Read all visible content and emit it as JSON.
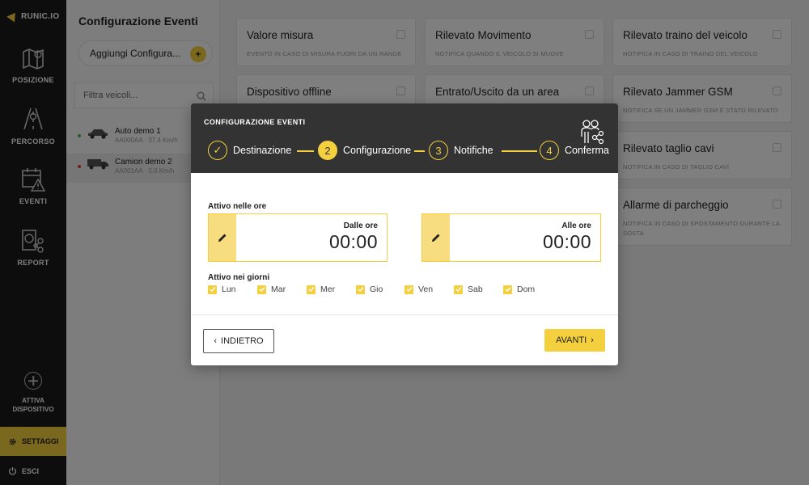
{
  "nav": {
    "brand": "RUNIC.IO",
    "items": [
      {
        "label": "POSIZIONE",
        "icon": "map-icon"
      },
      {
        "label": "PERCORSO",
        "icon": "route-icon"
      },
      {
        "label": "EVENTI",
        "icon": "calendar-alert-icon"
      },
      {
        "label": "REPORT",
        "icon": "report-icon"
      }
    ],
    "attiva": {
      "line1": "ATTIVA",
      "line2": "DISPOSITIVO"
    },
    "settings": "SETTAGGI",
    "logout": "ESCI"
  },
  "panel": {
    "title": "Configurazione Eventi",
    "add_button": "Aggiungi Configura...",
    "filter_placeholder": "Filtra veicoli...",
    "vehicles": [
      {
        "name": "Auto demo 1",
        "sub": "AA000AA · 37.4 Km/h",
        "status_color": "#4caf50",
        "icon": "car-icon"
      },
      {
        "name": "Camion demo 2",
        "sub": "AA001AA · 0.0 Km/h",
        "status_color": "#e53935",
        "icon": "truck-icon"
      }
    ]
  },
  "events": [
    {
      "title": "Valore misura",
      "desc": "Evento in caso di misura fuori da un range"
    },
    {
      "title": "Rilevato Movimento",
      "desc": "Notifica quando il veicolo si muove"
    },
    {
      "title": "Rilevato traino del veicolo",
      "desc": "Notifica in caso di traino del veicolo"
    },
    {
      "title": "Dispositivo offline",
      "desc": ""
    },
    {
      "title": "Entrato/Uscito da un area",
      "desc": ""
    },
    {
      "title": "Rilevato Jammer GSM",
      "desc": "Notifica se un Jammer GSM è stato rilevato"
    },
    {
      "title": "Rilevato taglio cavi",
      "desc": "Notifica in caso di taglio cavi"
    },
    {
      "title": "Allarme di parcheggio",
      "desc": "Notifica in caso di spostamento durante la sosta"
    }
  ],
  "modal": {
    "title": "CONFIGURAZIONE EVENTI",
    "steps": [
      {
        "num": "✓",
        "label": "Destinazione",
        "state": "done"
      },
      {
        "num": "2",
        "label": "Configurazione",
        "state": "active"
      },
      {
        "num": "3",
        "label": "Notifiche",
        "state": "todo"
      },
      {
        "num": "4",
        "label": "Conferma",
        "state": "todo"
      }
    ],
    "active_hours_label": "Attivo nelle ore",
    "from": {
      "caption": "Dalle ore",
      "value": "00:00"
    },
    "to": {
      "caption": "Alle ore",
      "value": "00:00"
    },
    "active_days_label": "Attivo nei giorni",
    "days": [
      "Lun",
      "Mar",
      "Mer",
      "Gio",
      "Ven",
      "Sab",
      "Dom"
    ],
    "back": "INDIETRO",
    "next": "AVANTI"
  },
  "colors": {
    "accent": "#f4d03f",
    "nav": "#1a1a1a",
    "modal_header": "#333333"
  }
}
